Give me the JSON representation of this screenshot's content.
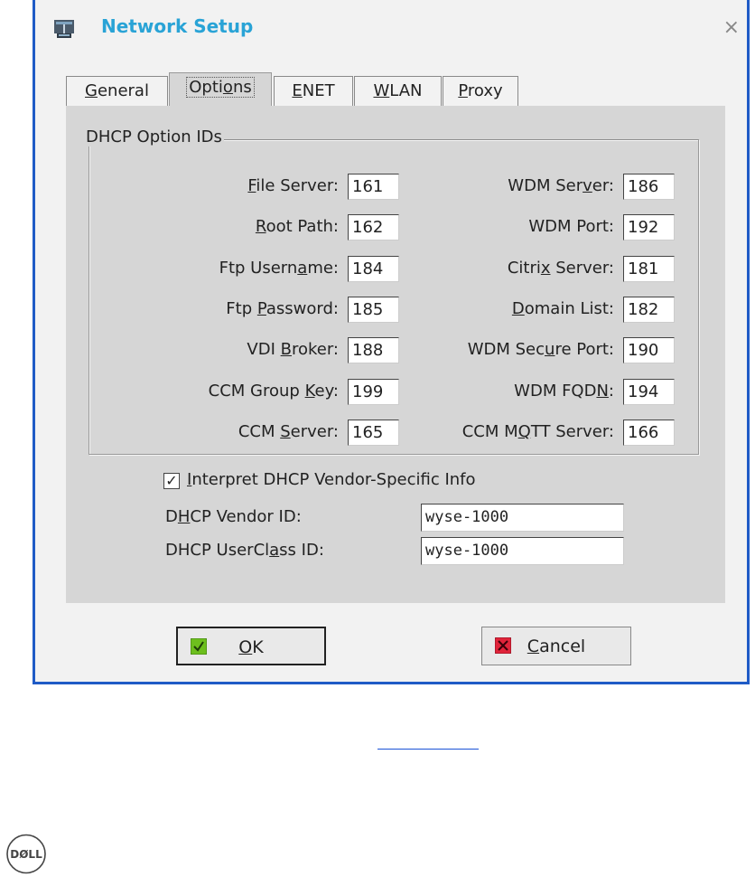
{
  "window": {
    "title": "Network Setup",
    "close_glyph": "×",
    "icon": "network-setup-icon"
  },
  "tabs": [
    {
      "label": "General",
      "mnemonic_index": 0,
      "active": false
    },
    {
      "label": "Options",
      "mnemonic_index": 4,
      "active": true
    },
    {
      "label": "ENET",
      "mnemonic_index": 0,
      "active": false
    },
    {
      "label": "WLAN",
      "mnemonic_index": 0,
      "active": false
    },
    {
      "label": "Proxy",
      "mnemonic_index": 0,
      "active": false
    }
  ],
  "dhcp_group": {
    "legend": "DHCP Option IDs",
    "left": [
      {
        "pre": "",
        "u": "F",
        "post": "ile Server:",
        "value": "161"
      },
      {
        "pre": "",
        "u": "R",
        "post": "oot Path:",
        "value": "162"
      },
      {
        "pre": "Ftp Usern",
        "u": "a",
        "post": "me:",
        "value": "184"
      },
      {
        "pre": "Ftp ",
        "u": "P",
        "post": "assword:",
        "value": "185"
      },
      {
        "pre": "VDI ",
        "u": "B",
        "post": "roker:",
        "value": "188"
      },
      {
        "pre": "CCM Group ",
        "u": "K",
        "post": "ey:",
        "value": "199"
      },
      {
        "pre": "CCM ",
        "u": "S",
        "post": "erver:",
        "value": "165"
      }
    ],
    "right": [
      {
        "pre": "WDM Ser",
        "u": "v",
        "post": "er:",
        "value": "186"
      },
      {
        "pre": "WDM Port:",
        "u": "",
        "post": "",
        "value": "192"
      },
      {
        "pre": "Citri",
        "u": "x",
        "post": " Server:",
        "value": "181"
      },
      {
        "pre": "",
        "u": "D",
        "post": "omain List:",
        "value": "182"
      },
      {
        "pre": "WDM Sec",
        "u": "u",
        "post": "re Port:",
        "value": "190"
      },
      {
        "pre": "WDM FQD",
        "u": "N",
        "post": ":",
        "value": "194"
      },
      {
        "pre": "CCM M",
        "u": "Q",
        "post": "TT Server:",
        "value": "166"
      }
    ]
  },
  "interpret": {
    "checked": true,
    "check_glyph": "✓",
    "pre": "",
    "u": "I",
    "post": "nterpret DHCP Vendor-Specific Info"
  },
  "vendor_id": {
    "pre": "D",
    "u": "H",
    "post": "CP Vendor ID:",
    "value": "wyse-1000"
  },
  "userclass_id": {
    "pre": "DHCP UserCl",
    "u": "a",
    "post": "ss ID:",
    "value": "wyse-1000"
  },
  "buttons": {
    "ok": {
      "u": "O",
      "post": "K",
      "icon": "check-icon",
      "color": "#6dbf1e"
    },
    "cancel": {
      "u": "C",
      "post": "ancel",
      "icon": "x-icon",
      "color": "#e0243a"
    }
  },
  "footer": {
    "logo_text": "DØLL"
  }
}
